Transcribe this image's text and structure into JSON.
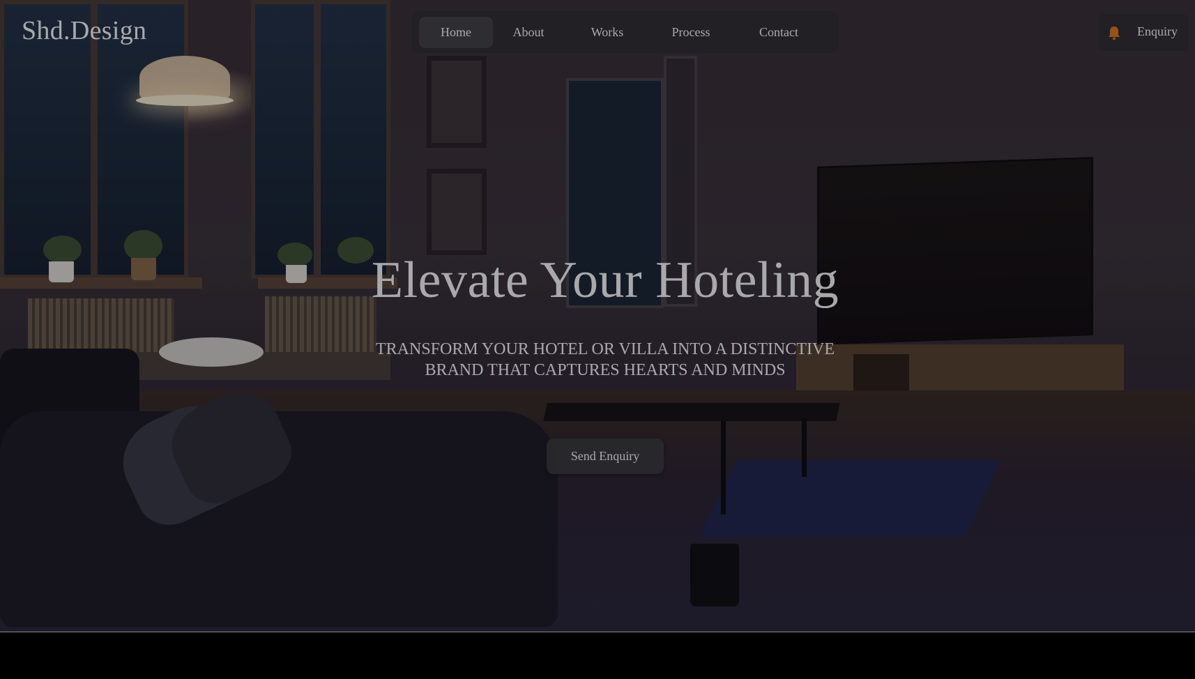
{
  "brand": {
    "logo_text": "Shd.Design"
  },
  "nav": {
    "items": [
      {
        "label": "Home",
        "active": true
      },
      {
        "label": "About",
        "active": false
      },
      {
        "label": "Works",
        "active": false
      },
      {
        "label": "Process",
        "active": false
      },
      {
        "label": "Contact",
        "active": false
      }
    ]
  },
  "header_action": {
    "label": "Enquiry",
    "icon": "bell-icon",
    "icon_color": "#e07b1e"
  },
  "hero": {
    "headline": "Elevate Your Hoteling",
    "subheadline": "TRANSFORM YOUR HOTEL OR VILLA INTO A DISTINCTIVE BRAND THAT CAPTURES HEARTS AND MINDS",
    "cta_label": "Send Enquiry"
  },
  "colors": {
    "nav_background": "#2d2b30",
    "active_tab": "#444448",
    "button_background": "#3a3a3c",
    "text": "#ffffff",
    "footer_band": "#000000"
  }
}
